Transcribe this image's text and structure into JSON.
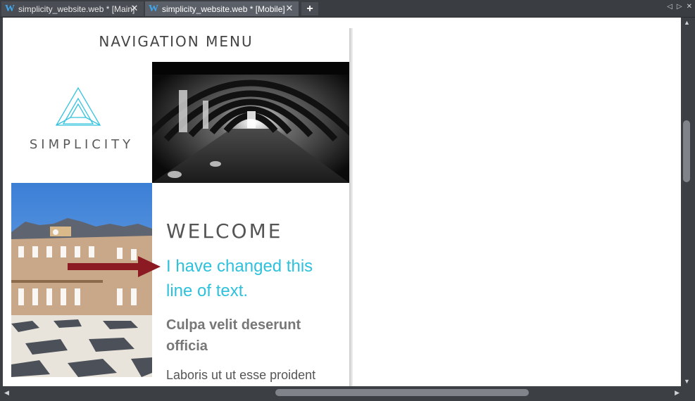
{
  "tabs": [
    {
      "label": "simplicity_website.web * [Main]",
      "icon": "webdesigner-w-icon"
    },
    {
      "label": "simplicity_website.web * [Mobile]",
      "icon": "webdesigner-w-icon",
      "active": true
    }
  ],
  "tab_close_glyph": "✕",
  "add_tab_glyph": "+",
  "page": {
    "nav_menu": "NAVIGATION MENU",
    "logo_text": "SIMPLICITY",
    "welcome": "WELCOME",
    "changed_text": "I have changed this line of text.",
    "culpa_heading": "Culpa velit deserunt officia",
    "laboris_text": "Laboris ut ut esse proident"
  },
  "colors": {
    "accent_cyan": "#2ec1dc",
    "arrow_red": "#8b1a22",
    "chrome_dark": "#3c3f43"
  }
}
